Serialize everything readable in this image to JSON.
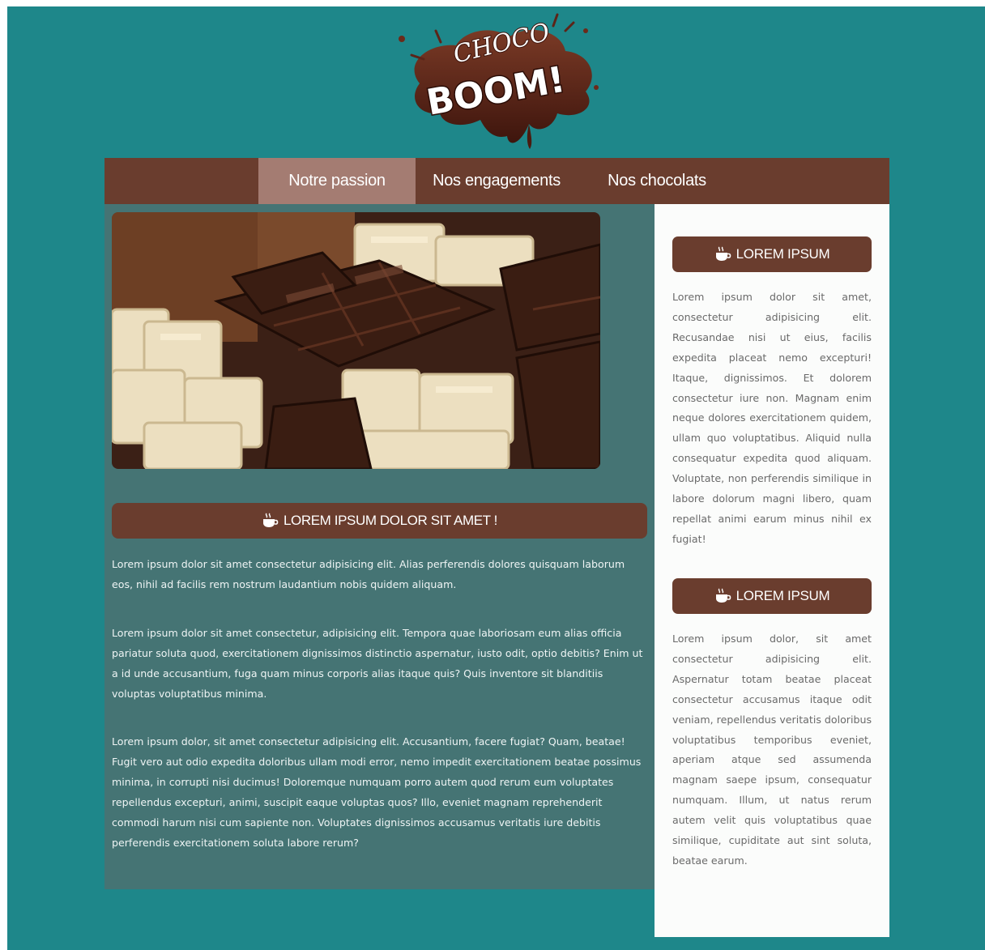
{
  "logo": {
    "line1": "CHOCO",
    "line2": "BOOM!",
    "colors": {
      "splash": "#5c2418",
      "text": "#ffffff"
    }
  },
  "nav": {
    "items": [
      {
        "label": "Notre passion",
        "active": true
      },
      {
        "label": "Nos engagements",
        "active": false
      },
      {
        "label": "Nos chocolats",
        "active": false
      }
    ]
  },
  "main": {
    "heading": "LOREM IPSUM DOLOR SIT AMET !",
    "heading_icon": "coffee-cup-icon",
    "paragraphs": [
      "Lorem ipsum dolor sit amet consectetur adipisicing elit. Alias perferendis dolores quisquam laborum eos, nihil ad facilis rem nostrum laudantium nobis quidem aliquam.",
      "Lorem ipsum dolor sit amet consectetur, adipisicing elit. Tempora quae laboriosam eum alias officia pariatur soluta quod, exercitationem dignissimos distinctio aspernatur, iusto odit, optio debitis? Enim ut a id unde accusantium, fuga quam minus corporis alias itaque quis? Quis inventore sit blanditiis voluptas voluptatibus minima.",
      "Lorem ipsum dolor, sit amet consectetur adipisicing elit. Accusantium, facere fugiat? Quam, beatae! Fugit vero aut odio expedita doloribus ullam modi error, nemo impedit exercitationem beatae possimus minima, in corrupti nisi ducimus! Doloremque numquam porro autem quod rerum eum voluptates repellendus excepturi, animi, suscipit eaque voluptas quos? Illo, eveniet magnam reprehenderit commodi harum nisi cum sapiente non. Voluptates dignissimos accusamus veritatis iure debitis perferendis exercitationem soluta labore rerum?"
    ]
  },
  "sidebar": {
    "blocks": [
      {
        "heading": "LOREM IPSUM",
        "text": "Lorem ipsum dolor sit amet, consectetur adipisicing elit. Recusandae nisi ut eius, facilis expedita placeat nemo excepturi! Itaque, dignissimos. Et dolorem consectetur iure non. Magnam enim neque dolores exercitationem quidem, ullam quo voluptatibus. Aliquid nulla consequatur expedita quod aliquam. Voluptate, non perferendis similique in labore dolorum magni libero, quam repellat animi earum minus nihil ex fugiat!"
      },
      {
        "heading": "LOREM IPSUM",
        "text": "Lorem ipsum dolor, sit amet consectetur adipisicing elit. Aspernatur totam beatae placeat consectetur accusamus itaque odit veniam, repellendus veritatis doloribus voluptatibus temporibus eveniet, aperiam atque sed assumenda magnam saepe ipsum, consequatur numquam. Illum, ut natus rerum autem velit quis voluptatibus quae similique, cupiditate aut sint soluta, beatae earum."
      }
    ]
  },
  "colors": {
    "page_background": "#1e878a",
    "nav_background": "#6a3d2e",
    "nav_active": "#a47c72",
    "main_background": "#457474",
    "sidebar_background": "#fbfcfb"
  }
}
